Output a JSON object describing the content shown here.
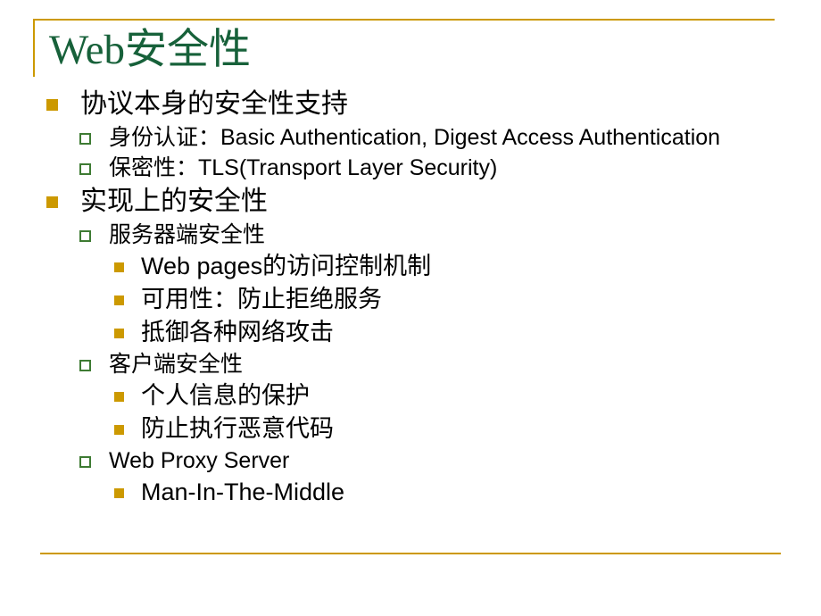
{
  "slide": {
    "title": "Web安全性",
    "title_color": "#17613A",
    "accent_color": "#CC9900",
    "bullet_level1_color": "#CC9900",
    "bullet_level2_color": "#3E7B33",
    "bullet_level3_color": "#CC9900",
    "background_color": "#FFFFFF",
    "text_color": "#000000"
  },
  "content": {
    "lines": [
      {
        "level": 1,
        "text": "协议本身的安全性支持"
      },
      {
        "level": 2,
        "text": "身份认证：Basic Authentication, Digest Access Authentication"
      },
      {
        "level": 2,
        "text": "保密性：TLS(Transport Layer Security)"
      },
      {
        "level": 1,
        "text": "实现上的安全性"
      },
      {
        "level": 2,
        "text": "服务器端安全性"
      },
      {
        "level": 3,
        "text": "Web pages的访问控制机制"
      },
      {
        "level": 3,
        "text": "可用性：防止拒绝服务"
      },
      {
        "level": 3,
        "text": "抵御各种网络攻击"
      },
      {
        "level": 2,
        "text": "客户端安全性"
      },
      {
        "level": 3,
        "text": "个人信息的保护"
      },
      {
        "level": 3,
        "text": "防止执行恶意代码"
      },
      {
        "level": 2,
        "text": "Web Proxy Server"
      },
      {
        "level": 3,
        "text": "Man-In-The-Middle"
      }
    ]
  }
}
